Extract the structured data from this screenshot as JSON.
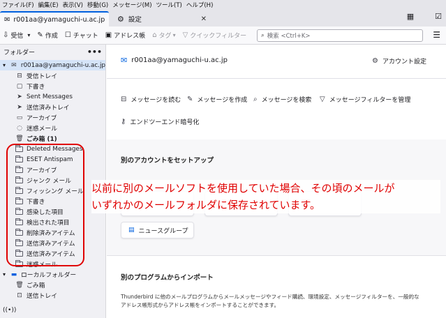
{
  "menu": [
    "ファイル(F)",
    "編集(E)",
    "表示(V)",
    "移動(G)",
    "メッセージ(M)",
    "ツール(T)",
    "ヘルプ(H)"
  ],
  "tabs": [
    {
      "label": "r001aa@yamaguchi-u.ac.jp",
      "icon": "mail-icon"
    },
    {
      "label": "設定",
      "icon": "gear-icon"
    }
  ],
  "toolbar": {
    "receive": "受信",
    "compose": "作成",
    "chat": "チャット",
    "addressbook": "アドレス帳",
    "tag": "タグ",
    "quickfilter": "クイックフィルター",
    "search_placeholder": "検索 <Ctrl+K>"
  },
  "folder_pane": {
    "title": "フォルダー",
    "account": "r001aa@yamaguchi-u.ac.jp",
    "folders": [
      {
        "label": "受信トレイ",
        "icon": "inbox-icon"
      },
      {
        "label": "下書き",
        "icon": "draft-icon"
      },
      {
        "label": "Sent Messages",
        "icon": "send-icon"
      },
      {
        "label": "送信済みトレイ",
        "icon": "send-icon"
      },
      {
        "label": "アーカイブ",
        "icon": "archive-icon"
      },
      {
        "label": "迷惑メール",
        "icon": "junk-icon"
      },
      {
        "label": "ごみ箱 (1)",
        "icon": "trash-icon"
      },
      {
        "label": "Deleted Messages",
        "icon": "folder-icon"
      },
      {
        "label": "ESET Antispam",
        "icon": "folder-icon"
      },
      {
        "label": "アーカイブ",
        "icon": "folder-icon"
      },
      {
        "label": "ジャンク メール",
        "icon": "folder-icon"
      },
      {
        "label": "フィッシング メール",
        "icon": "folder-icon"
      },
      {
        "label": "下書き",
        "icon": "folder-icon"
      },
      {
        "label": "感染した項目",
        "icon": "folder-icon"
      },
      {
        "label": "検出された項目",
        "icon": "folder-icon"
      },
      {
        "label": "削除済みアイテム",
        "icon": "folder-icon"
      },
      {
        "label": "送信済みアイテム",
        "icon": "folder-icon"
      },
      {
        "label": "送信済みアイテム",
        "icon": "folder-icon"
      },
      {
        "label": "迷惑メール",
        "icon": "folder-icon"
      }
    ],
    "local_title": "ローカルフォルダー",
    "local_folders": [
      {
        "label": "ごみ箱",
        "icon": "trash-icon"
      },
      {
        "label": "送信トレイ",
        "icon": "outbox-icon"
      }
    ]
  },
  "main": {
    "account_email": "r001aa@yamaguchi-u.ac.jp",
    "account_settings": "アカウント設定",
    "actions": [
      "メッセージを読む",
      "メッセージを作成",
      "メッセージを検索",
      "メッセージフィルターを管理"
    ],
    "e2e": "エンドツーエンド暗号化",
    "setup_title": "別のアカウントをセットアップ",
    "newsgroup": "ニュースグループ",
    "import_title": "別のプログラムからインポート",
    "import_desc": "Thunderbird に他のメールプログラムからメールメッセージやフィード購読、環境設定、メッセージフィルターを、一般的な",
    "import_desc2": "アドレス帳形式からアドレス帳をインポートすることができます。"
  },
  "annotation": {
    "line1": "以前に別のメールソフトを使用していた場合、その頃のメールが",
    "line2": "いずれかのメールフォルダに保存されています。",
    "color": "#e00000"
  },
  "colors": {
    "accent": "#0060df",
    "selection": "#d5e4f8"
  }
}
